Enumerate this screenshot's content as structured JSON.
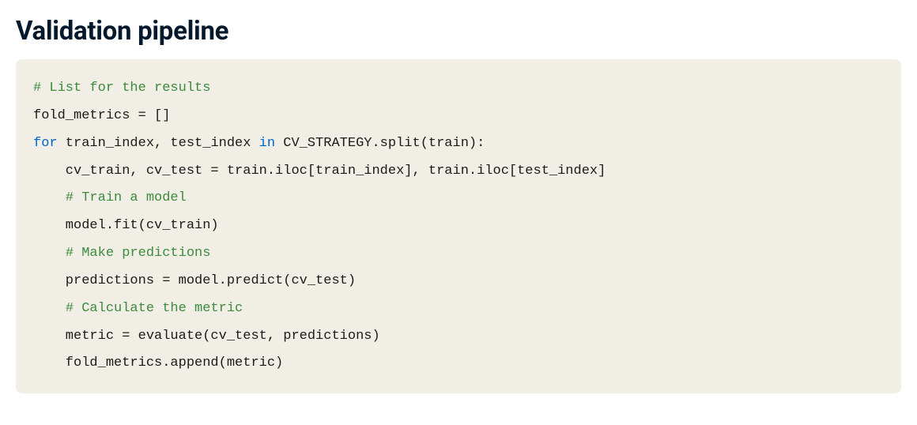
{
  "heading": "Validation pipeline",
  "code": {
    "lines": [
      {
        "parts": [
          {
            "cls": "token-comment",
            "text": "# List for the results"
          }
        ]
      },
      {
        "parts": [
          {
            "cls": "",
            "text": "fold_metrics = []"
          }
        ]
      },
      {
        "parts": [
          {
            "cls": "token-keyword",
            "text": "for"
          },
          {
            "cls": "",
            "text": " train_index, test_index "
          },
          {
            "cls": "token-keyword",
            "text": "in"
          },
          {
            "cls": "",
            "text": " CV_STRATEGY.split(train):"
          }
        ]
      },
      {
        "parts": [
          {
            "cls": "",
            "text": "    cv_train, cv_test = train.iloc[train_index], train.iloc[test_index]"
          }
        ]
      },
      {
        "parts": [
          {
            "cls": "",
            "text": "    "
          },
          {
            "cls": "token-comment",
            "text": "# Train a model"
          }
        ]
      },
      {
        "parts": [
          {
            "cls": "",
            "text": "    model.fit(cv_train)"
          }
        ]
      },
      {
        "parts": [
          {
            "cls": "",
            "text": "    "
          },
          {
            "cls": "token-comment",
            "text": "# Make predictions"
          }
        ]
      },
      {
        "parts": [
          {
            "cls": "",
            "text": "    predictions = model.predict(cv_test)"
          }
        ]
      },
      {
        "parts": [
          {
            "cls": "",
            "text": "    "
          },
          {
            "cls": "token-comment",
            "text": "# Calculate the metric"
          }
        ]
      },
      {
        "parts": [
          {
            "cls": "",
            "text": "    metric = evaluate(cv_test, predictions)"
          }
        ]
      },
      {
        "parts": [
          {
            "cls": "",
            "text": "    fold_metrics.append(metric)"
          }
        ]
      }
    ]
  }
}
